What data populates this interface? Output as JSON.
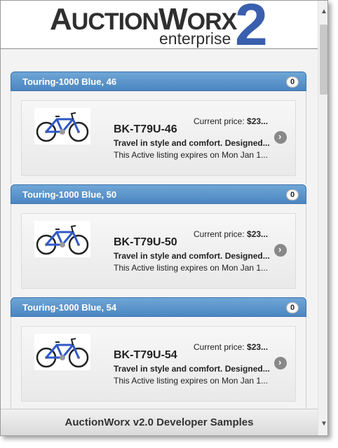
{
  "header": {
    "logo_big": "A",
    "logo_small": "UCTION",
    "logo_big2": "W",
    "logo_small2": "ORX",
    "logo_sub": "enterprise",
    "logo_two": "2"
  },
  "items": [
    {
      "title": "Touring-1000 Blue, 46",
      "badge": "0",
      "price_label": "Current price: ",
      "price_value": "$23...",
      "sku": "BK-T79U-46",
      "description": "Travel in style and comfort. Designed...",
      "expires": "This Active listing expires on Mon Jan 1..."
    },
    {
      "title": "Touring-1000 Blue, 50",
      "badge": "0",
      "price_label": "Current price: ",
      "price_value": "$23...",
      "sku": "BK-T79U-50",
      "description": "Travel in style and comfort. Designed...",
      "expires": "This Active listing expires on Mon Jan 1..."
    },
    {
      "title": "Touring-1000 Blue, 54",
      "badge": "0",
      "price_label": "Current price: ",
      "price_value": "$23...",
      "sku": "BK-T79U-54",
      "description": "Travel in style and comfort. Designed...",
      "expires": "This Active listing expires on Mon Jan 1..."
    }
  ],
  "footer": {
    "text": "AuctionWorx v2.0 Developer Samples"
  },
  "icons": {
    "go": "chevron-right-icon",
    "bike": "bicycle-image"
  },
  "colors": {
    "header_blue": "#4b86c1",
    "logo_two": "#3a5fae"
  }
}
